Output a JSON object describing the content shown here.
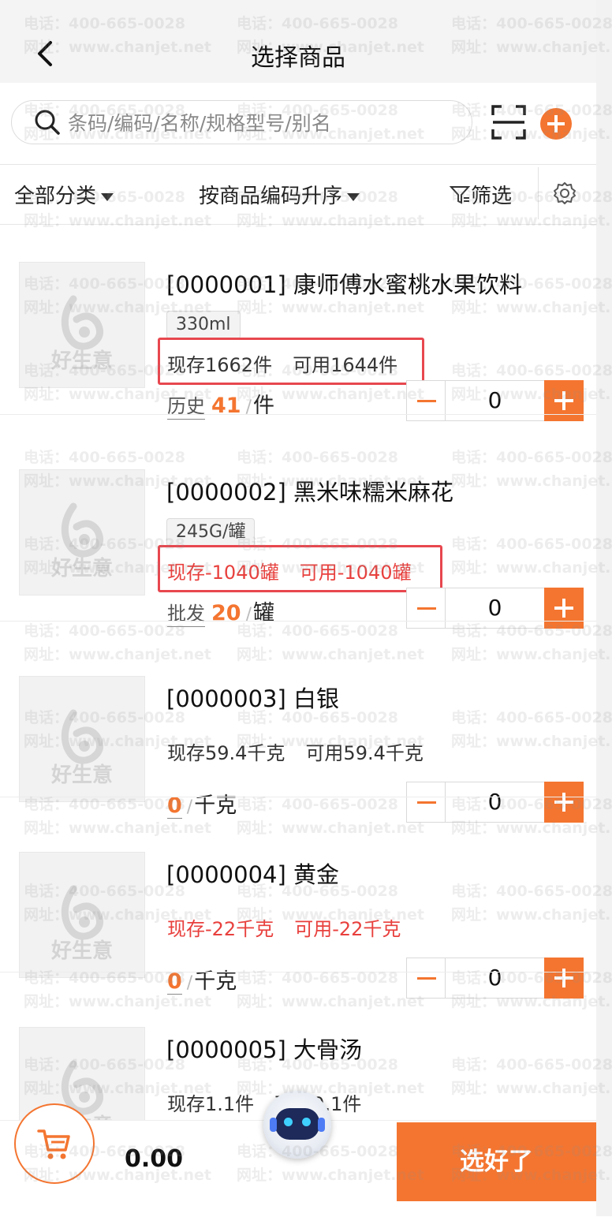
{
  "header": {
    "title": "选择商品"
  },
  "search": {
    "placeholder": "条码/编码/名称/规格型号/别名"
  },
  "filters": {
    "category": "全部分类",
    "sort": "按商品编码升序",
    "filter": "筛选"
  },
  "products": [
    {
      "name": "[0000001] 康师傅水蜜桃水果饮料",
      "spec": "330ml",
      "stock_text": "现存1662件",
      "available_text": "可用1644件",
      "stock_negative": false,
      "highlighted": true,
      "price_label": "历史",
      "price": "41",
      "unit": "件",
      "qty": "0"
    },
    {
      "name": "[0000002] 黑米味糯米麻花",
      "spec": "245G/罐",
      "stock_text": "现存-1040罐",
      "available_text": "可用-1040罐",
      "stock_negative": true,
      "highlighted": true,
      "price_label": "批发",
      "price": "20",
      "unit": "罐",
      "qty": "0"
    },
    {
      "name": "[0000003] 白银",
      "spec": "",
      "stock_text": "现存59.4千克",
      "available_text": "可用59.4千克",
      "stock_negative": false,
      "highlighted": false,
      "price_label": "",
      "price": "0",
      "unit": "千克",
      "qty": "0"
    },
    {
      "name": "[0000004] 黄金",
      "spec": "",
      "stock_text": "现存-22千克",
      "available_text": "可用-22千克",
      "stock_negative": true,
      "highlighted": false,
      "price_label": "",
      "price": "0",
      "unit": "千克",
      "qty": "0"
    },
    {
      "name": "[0000005] 大骨汤",
      "spec": "",
      "stock_text": "现存1.1件",
      "available_text": "可用0.1件",
      "stock_negative": false,
      "highlighted": false,
      "price_label": "",
      "price": "",
      "unit": "",
      "qty": ""
    }
  ],
  "thumb_logo_text": "好生意",
  "watermark": {
    "phone": "电话：400-665-0028",
    "url": "网址：www.chanjet.net"
  },
  "footer": {
    "total": "0.00",
    "confirm_label": "选好了"
  },
  "colors": {
    "accent": "#f47530",
    "negative": "#e8403d",
    "highlight_box": "#e8474f"
  },
  "icons": [
    "back-icon",
    "search-icon",
    "scan-icon",
    "add-icon",
    "filter-icon",
    "settings-icon",
    "cart-icon",
    "assistant-robot-icon"
  ]
}
